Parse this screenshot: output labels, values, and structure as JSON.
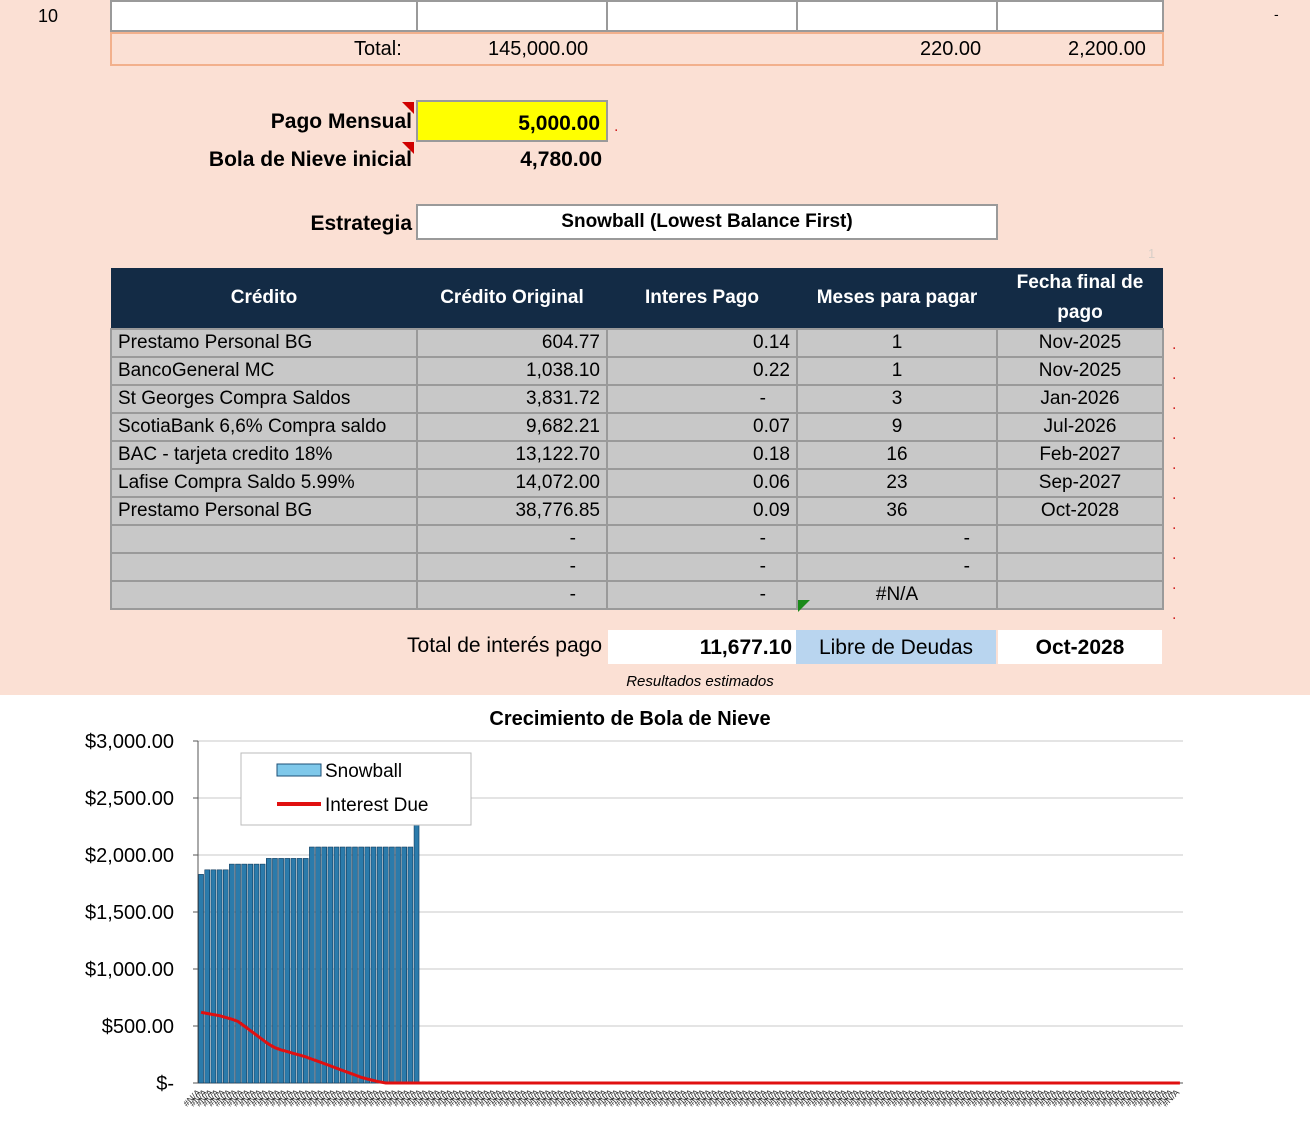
{
  "sheet": {
    "row_number": "10",
    "right_dash": "-",
    "totals": {
      "label": "Total:",
      "original": "145,000.00",
      "payment": "220.00",
      "last": "2,200.00"
    },
    "pago_mensual": {
      "label": "Pago Mensual",
      "value": "5,000.00"
    },
    "bola_inicial": {
      "label": "Bola de Nieve inicial",
      "value": "4,780.00"
    },
    "estrategia": {
      "label": "Estrategia",
      "value": "Snowball (Lowest Balance First)"
    },
    "faint_number": "1",
    "table": {
      "headers": [
        "Crédito",
        "Crédito Original",
        "Interes Pago",
        "Meses para pagar",
        "Fecha final de pago"
      ],
      "rows": [
        [
          "Prestamo Personal BG",
          "604.77",
          "0.14",
          "1",
          "Nov-2025"
        ],
        [
          "BancoGeneral MC",
          "1,038.10",
          "0.22",
          "1",
          "Nov-2025"
        ],
        [
          "St Georges Compra Saldos",
          "3,831.72",
          "-",
          "3",
          "Jan-2026"
        ],
        [
          "ScotiaBank 6,6% Compra saldo",
          "9,682.21",
          "0.07",
          "9",
          "Jul-2026"
        ],
        [
          "BAC - tarjeta credito 18%",
          "13,122.70",
          "0.18",
          "16",
          "Feb-2027"
        ],
        [
          "Lafise Compra Saldo 5.99%",
          "14,072.00",
          "0.06",
          "23",
          "Sep-2027"
        ],
        [
          "Prestamo Personal BG",
          "38,776.85",
          "0.09",
          "36",
          "Oct-2028"
        ],
        [
          "",
          "-",
          "-",
          "-",
          ""
        ],
        [
          "",
          "-",
          "-",
          "-",
          ""
        ],
        [
          "",
          "-",
          "-",
          "#N/A",
          ""
        ]
      ]
    },
    "total_interes": {
      "label": "Total de interés pago",
      "value": "11,677.10"
    },
    "libre": {
      "label": "Libre de Deudas",
      "value": "Oct-2028"
    },
    "resultados": "Resultados estimados"
  },
  "colors": {
    "sheet_bg": "#fbe0d4",
    "header_bg": "#132b45",
    "highlight": "#ffff00",
    "libre_bg": "#b9d5ef",
    "bar_fill": "#2b7bab",
    "interest_line": "#e01010"
  },
  "chart_data": {
    "type": "bar",
    "title": "Crecimiento de Bola de Nieve",
    "ylim": [
      0,
      3000
    ],
    "yticks": [
      "$3,000.00",
      "$2,500.00",
      "$2,000.00",
      "$1,500.00",
      "$1,000.00",
      "$500.00",
      "$-"
    ],
    "ytick_values": [
      3000,
      2500,
      2000,
      1500,
      1000,
      500,
      0
    ],
    "legend_position": "top-left",
    "grid": true,
    "series": [
      {
        "name": "Snowball",
        "kind": "bar",
        "values": [
          1830,
          1870,
          1870,
          1870,
          1870,
          1920,
          1920,
          1920,
          1920,
          1920,
          1920,
          1970,
          1970,
          1970,
          1970,
          1970,
          1970,
          1970,
          2070,
          2070,
          2070,
          2070,
          2070,
          2070,
          2070,
          2070,
          2070,
          2070,
          2070,
          2070,
          2070,
          2070,
          2070,
          2070,
          2070,
          2300
        ]
      },
      {
        "name": "Interest Due",
        "kind": "line",
        "values": [
          620,
          610,
          600,
          590,
          575,
          560,
          540,
          500,
          460,
          420,
          380,
          340,
          310,
          290,
          275,
          260,
          245,
          230,
          210,
          190,
          170,
          150,
          130,
          110,
          90,
          70,
          50,
          35,
          22,
          10,
          0
        ]
      }
    ],
    "n_categories": 160,
    "xtick_label": "#N/A"
  }
}
